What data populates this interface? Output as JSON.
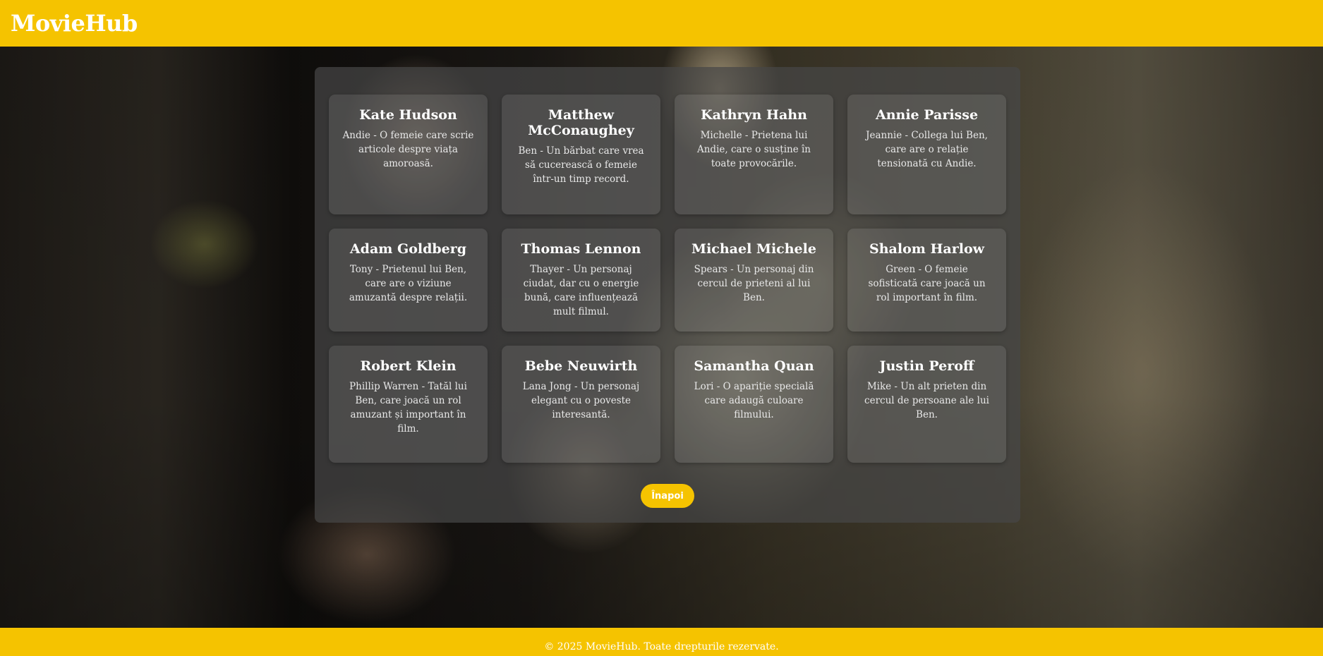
{
  "header": {
    "logo": "MovieHub"
  },
  "cast": [
    {
      "name": "Kate Hudson",
      "role": "Andie - O femeie care scrie articole despre viața amoroasă."
    },
    {
      "name": "Matthew McConaughey",
      "role": "Ben - Un bărbat care vrea să cucerească o femeie într-un timp record."
    },
    {
      "name": "Kathryn Hahn",
      "role": "Michelle - Prietena lui Andie, care o susține în toate provocările."
    },
    {
      "name": "Annie Parisse",
      "role": "Jeannie - Collega lui Ben, care are o relație tensionată cu Andie."
    },
    {
      "name": "Adam Goldberg",
      "role": "Tony - Prietenul lui Ben, care are o viziune amuzantă despre relații."
    },
    {
      "name": "Thomas Lennon",
      "role": "Thayer - Un personaj ciudat, dar cu o energie bună, care influențează mult filmul."
    },
    {
      "name": "Michael Michele",
      "role": "Spears - Un personaj din cercul de prieteni al lui Ben."
    },
    {
      "name": "Shalom Harlow",
      "role": "Green - O femeie sofisticată care joacă un rol important în film."
    },
    {
      "name": "Robert Klein",
      "role": "Phillip Warren - Tatăl lui Ben, care joacă un rol amuzant și important în film."
    },
    {
      "name": "Bebe Neuwirth",
      "role": "Lana Jong - Un personaj elegant cu o poveste interesantă."
    },
    {
      "name": "Samantha Quan",
      "role": "Lori - O apariție specială care adaugă culoare filmului."
    },
    {
      "name": "Justin Peroff",
      "role": "Mike - Un alt prieten din cercul de persoane ale lui Ben."
    }
  ],
  "back_button": {
    "label": "Înapoi"
  },
  "footer": {
    "text": "© 2025 MovieHub. Toate drepturile rezervate."
  },
  "colors": {
    "accent": "#f5c300",
    "panel": "#464646",
    "text": "#ffffff"
  }
}
